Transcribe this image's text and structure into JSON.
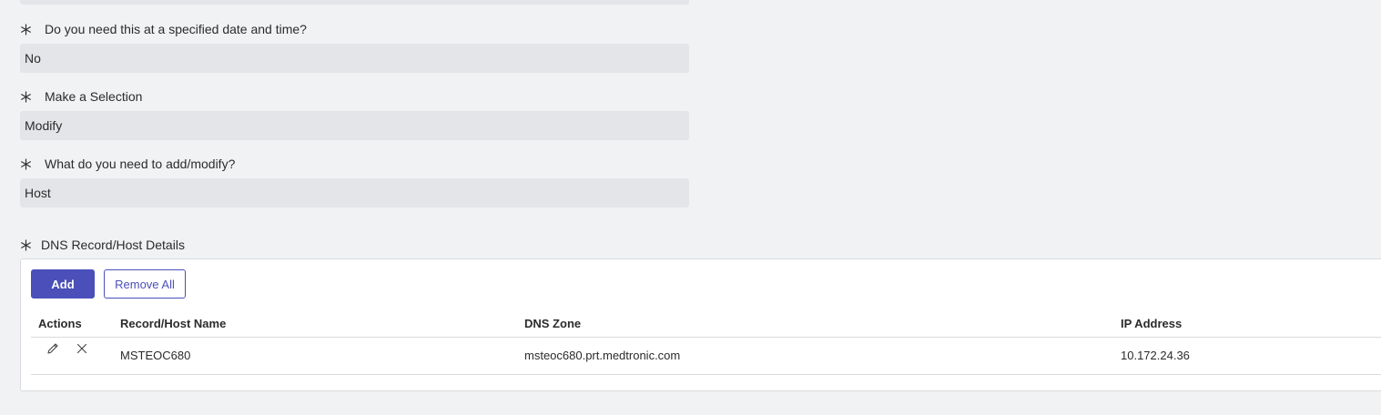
{
  "questions": [
    {
      "label": "Do you need this at a specified date and time?",
      "value": "No"
    },
    {
      "label": "Make a Selection",
      "value": "Modify"
    },
    {
      "label": "What do you need to add/modify?",
      "value": "Host"
    }
  ],
  "dns": {
    "label": "DNS Record/Host Details",
    "add_label": "Add",
    "remove_all_label": "Remove All",
    "columns": [
      "Actions",
      "Record/Host Name",
      "DNS Zone",
      "IP Address"
    ],
    "rows": [
      {
        "name": "MSTEOC680",
        "zone": "msteoc680.prt.medtronic.com",
        "ip": "10.172.24.36",
        "icons": [
          "edit-icon",
          "delete-icon"
        ]
      }
    ]
  },
  "colors": {
    "accent": "#4b4fb9",
    "field_bg": "#e4e5e8",
    "page_bg": "#f1f2f4"
  }
}
